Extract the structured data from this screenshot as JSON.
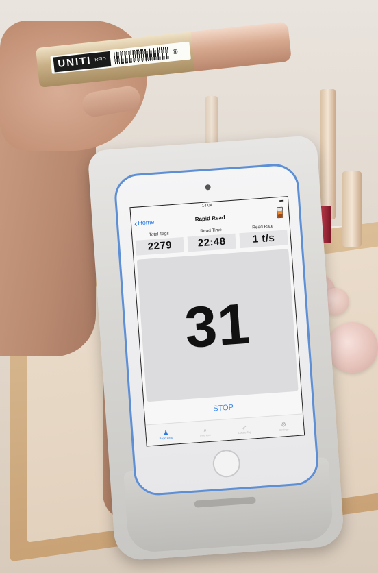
{
  "product": {
    "brand": "UNITI",
    "brand_sub": "RFID"
  },
  "app": {
    "status_time": "14:04",
    "nav_back_label": "Home",
    "title": "Rapid Read",
    "stats": [
      {
        "label": "Total Tags",
        "value": "2279"
      },
      {
        "label": "Read Time",
        "value": "22:48"
      },
      {
        "label": "Read Rate",
        "value": "1 t/s"
      }
    ],
    "live_count": "31",
    "stop_label": "STOP",
    "tabs": [
      {
        "icon": "person-icon",
        "label": "Rapid Read",
        "active": true
      },
      {
        "icon": "search-icon",
        "label": "Inventory",
        "active": false
      },
      {
        "icon": "locate-icon",
        "label": "Locate Tag",
        "active": false
      },
      {
        "icon": "settings-icon",
        "label": "Settings",
        "active": false
      }
    ]
  },
  "colors": {
    "accent": "#2a7ae4",
    "device_trim": "#5d8fd6"
  }
}
